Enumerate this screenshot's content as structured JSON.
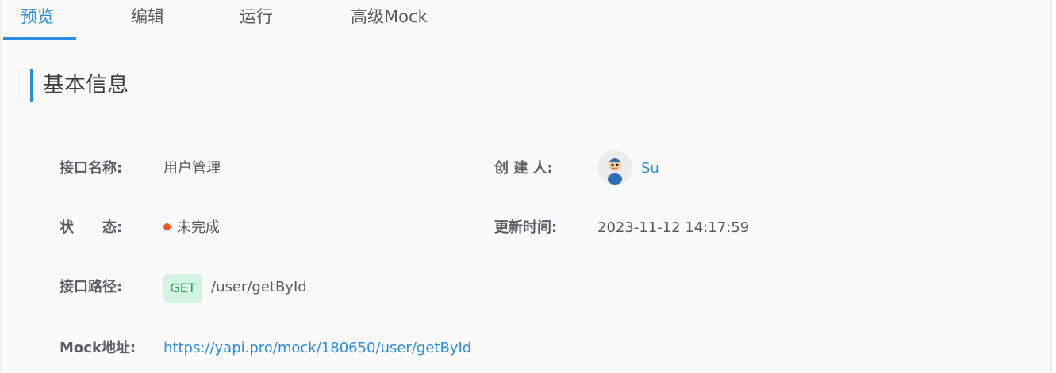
{
  "tabs": [
    {
      "label": "预览"
    },
    {
      "label": "编辑"
    },
    {
      "label": "运行"
    },
    {
      "label": "高级Mock"
    }
  ],
  "section": {
    "title": "基本信息"
  },
  "info": {
    "name_label": "接口名称:",
    "name_value": "用户管理",
    "creator_label": "创 建 人:",
    "creator_value": "Su",
    "status_label": "状　　态:",
    "status_value": "未完成",
    "updated_label": "更新时间:",
    "updated_value": "2023-11-12 14:17:59",
    "path_label": "接口路径:",
    "method": "GET",
    "path_value": "/user/getById",
    "mock_label": "Mock地址:",
    "mock_value": "https://yapi.pro/mock/180650/user/getById"
  },
  "colors": {
    "accent": "#2a8ddf",
    "status_dot": "#fa541c",
    "method_bg": "#d4f4e2",
    "method_text": "#1fa25a"
  }
}
